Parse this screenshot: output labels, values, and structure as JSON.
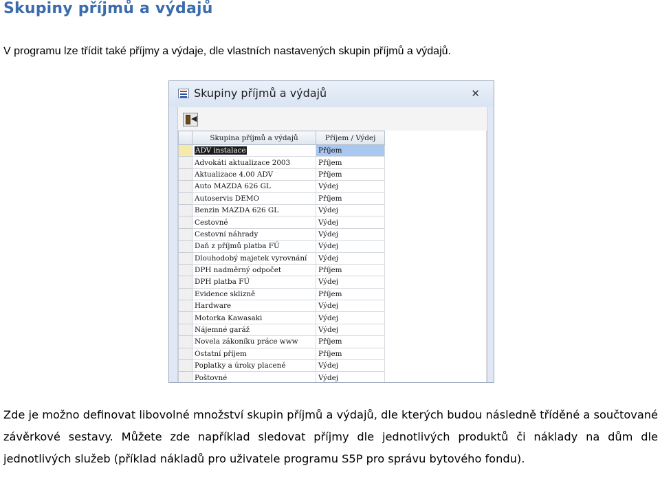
{
  "heading": "Skupiny příjmů a výdajů",
  "intro": "V programu lze třídit také příjmy a výdaje, dle vlastních nastavených skupin příjmů a výdajů.",
  "window": {
    "title": "Skupiny příjmů a výdajů",
    "close": "✕",
    "columns": [
      "Skupina příjmů a výdajů",
      "Příjem / Výdej"
    ],
    "rows": [
      {
        "name": "ADV instalace",
        "type": "Příjem"
      },
      {
        "name": "Advokáti aktualizace 2003",
        "type": "Příjem"
      },
      {
        "name": "Aktualizace 4.00 ADV",
        "type": "Příjem"
      },
      {
        "name": "Auto MAZDA 626 GL",
        "type": "Výdej"
      },
      {
        "name": "Autoservis DEMO",
        "type": "Příjem"
      },
      {
        "name": "Benzin MAZDA 626 GL",
        "type": "Výdej"
      },
      {
        "name": "Cestovné",
        "type": "Výdej"
      },
      {
        "name": "Cestovní náhrady",
        "type": "Výdej"
      },
      {
        "name": "Daň z příjmů platba FÚ",
        "type": "Výdej"
      },
      {
        "name": "Dlouhodobý majetek vyrovnání",
        "type": "Výdej"
      },
      {
        "name": "DPH nadměrný odpočet",
        "type": "Příjem"
      },
      {
        "name": "DPH platba FÚ",
        "type": "Výdej"
      },
      {
        "name": "Evidence sklizně",
        "type": "Příjem"
      },
      {
        "name": "Hardware",
        "type": "Výdej"
      },
      {
        "name": "Motorka Kawasaki",
        "type": "Výdej"
      },
      {
        "name": "Nájemné garáž",
        "type": "Výdej"
      },
      {
        "name": "Novela zákoníku práce www",
        "type": "Příjem"
      },
      {
        "name": "Ostatní příjem",
        "type": "Příjem"
      },
      {
        "name": "Poplatky a úroky placené",
        "type": "Výdej"
      },
      {
        "name": "Poštovné",
        "type": "Výdej"
      }
    ]
  },
  "paragraph": "Zde je možno definovat libovolné množství skupin příjmů a výdajů, dle kterých budou následně tříděné a součtované závěrkové sestavy. Můžete zde například sledovat příjmy dle jednotlivých produktů či náklady na dům dle jednotlivých služeb (příklad nákladů pro uživatele programu S5P pro správu bytového fondu)."
}
